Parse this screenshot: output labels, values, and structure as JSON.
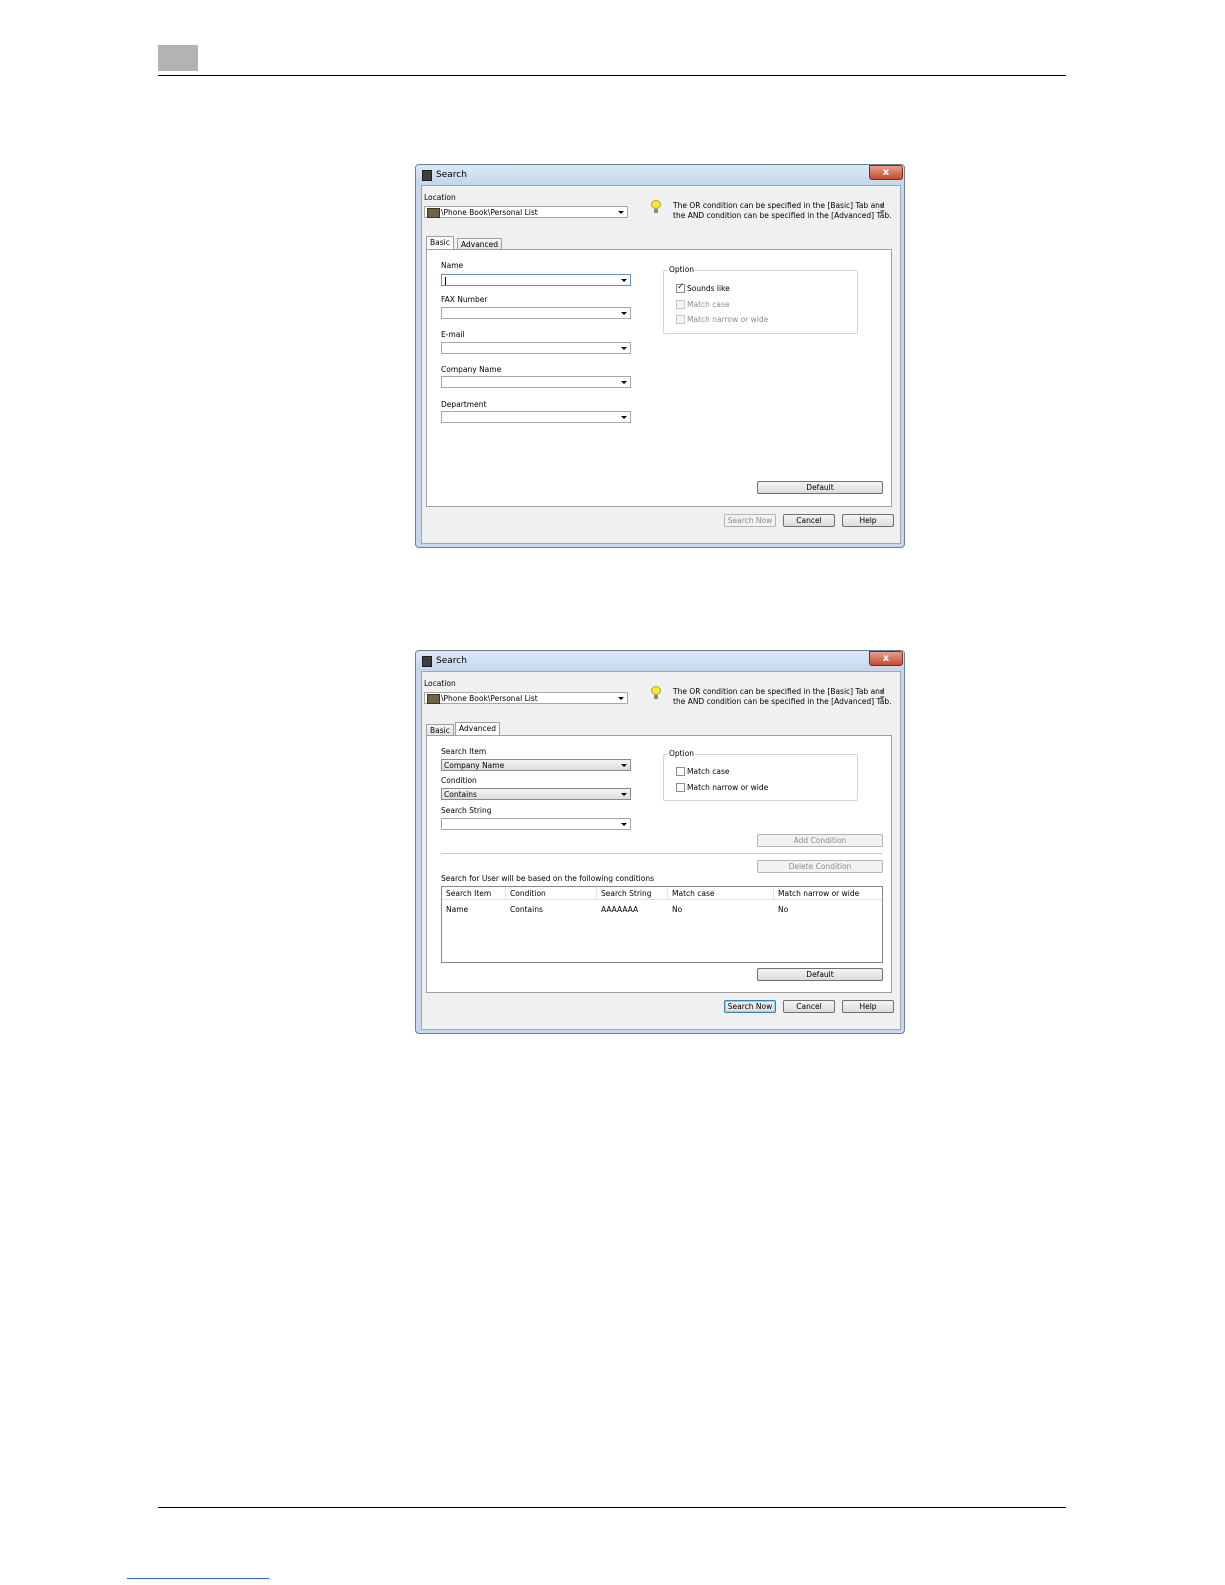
{
  "common": {
    "window_title": "Search",
    "close_glyph": "x",
    "location_label": "Location",
    "location_value": "\\Phone Book\\Personal List",
    "info_line1": "The OR condition can be specified in the [Basic] Tab and",
    "info_line2": "the AND condition can be specified in the [Advanced] Tab.",
    "tab_basic": "Basic",
    "tab_advanced": "Advanced",
    "option_title": "Option",
    "default_button": "Default",
    "search_now_button": "Search Now",
    "cancel_button": "Cancel",
    "help_button": "Help"
  },
  "basic": {
    "name_label": "Name",
    "fax_label": "FAX Number",
    "email_label": "E-mail",
    "company_label": "Company Name",
    "department_label": "Department",
    "sounds_like_label": "Sounds like",
    "sounds_like_checked": true,
    "match_case_label": "Match case",
    "match_narrow_label": "Match narrow or wide"
  },
  "advanced": {
    "search_item_label": "Search Item",
    "search_item_value": "Company Name",
    "condition_label": "Condition",
    "condition_value": "Contains",
    "search_string_label": "Search String",
    "match_case_label": "Match case",
    "match_narrow_label": "Match narrow or wide",
    "add_condition_button": "Add Condition",
    "delete_condition_button": "Delete Condition",
    "conditions_caption": "Search for User will be based on the following conditions",
    "table": {
      "headers": [
        "Search Item",
        "Condition",
        "Search String",
        "Match case",
        "Match narrow or wide"
      ],
      "rows": [
        [
          "Name",
          "Contains",
          "AAAAAAA",
          "No",
          "No"
        ]
      ]
    }
  }
}
